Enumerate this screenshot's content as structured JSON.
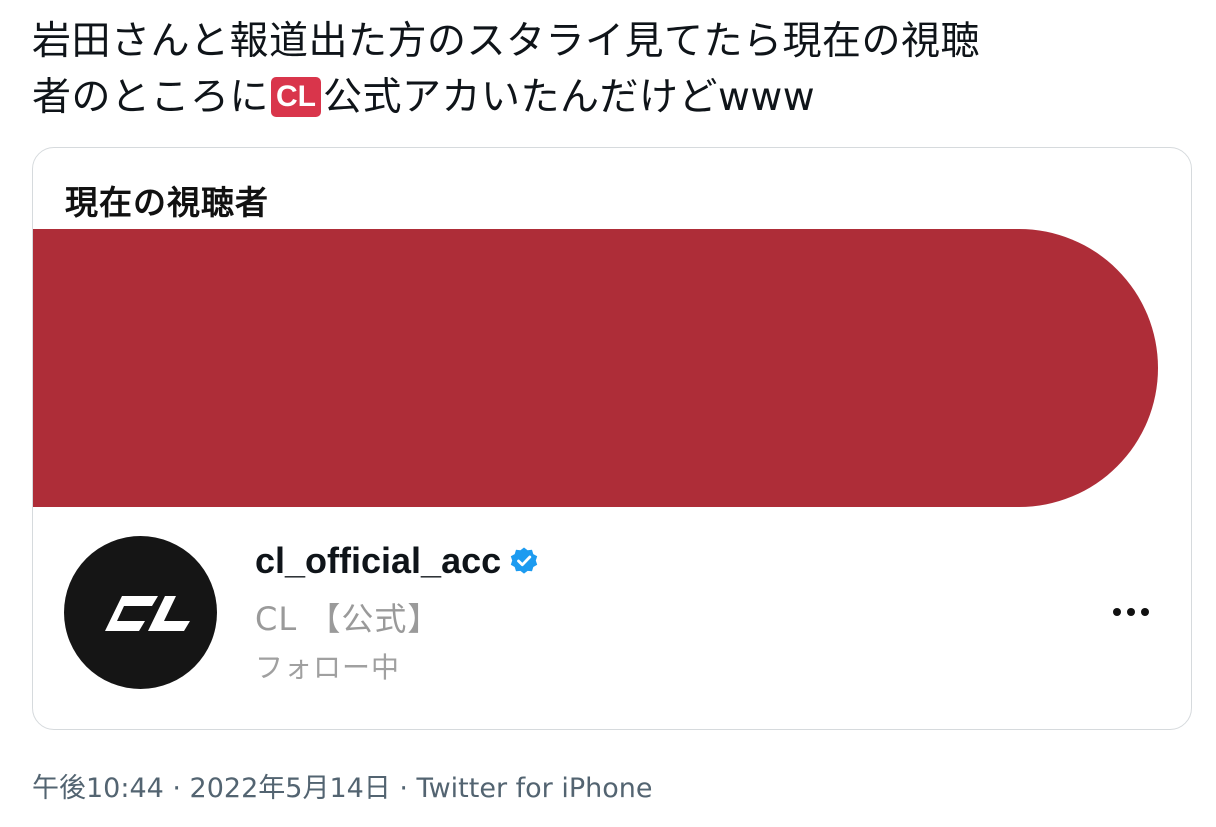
{
  "tweet": {
    "text_line1": "岩田さんと報道出た方のスタライ見てたら現在の視聴",
    "text_line2_pre": "者のところに",
    "emoji_label": "CL",
    "text_line2_post": "公式アカいたんだけどwww"
  },
  "card": {
    "title": "現在の視聴者",
    "redaction_color": "#ae2d38",
    "account": {
      "username": "cl_official_acc",
      "display_name": "CL 【公式】",
      "follow_status": "フォロー中",
      "avatar_logo": "CL",
      "verified_icon": "verified-badge-icon",
      "more_icon": "more-options-icon"
    }
  },
  "meta": {
    "text": "午後10:44 · 2022年5月14日 · Twitter for iPhone"
  }
}
